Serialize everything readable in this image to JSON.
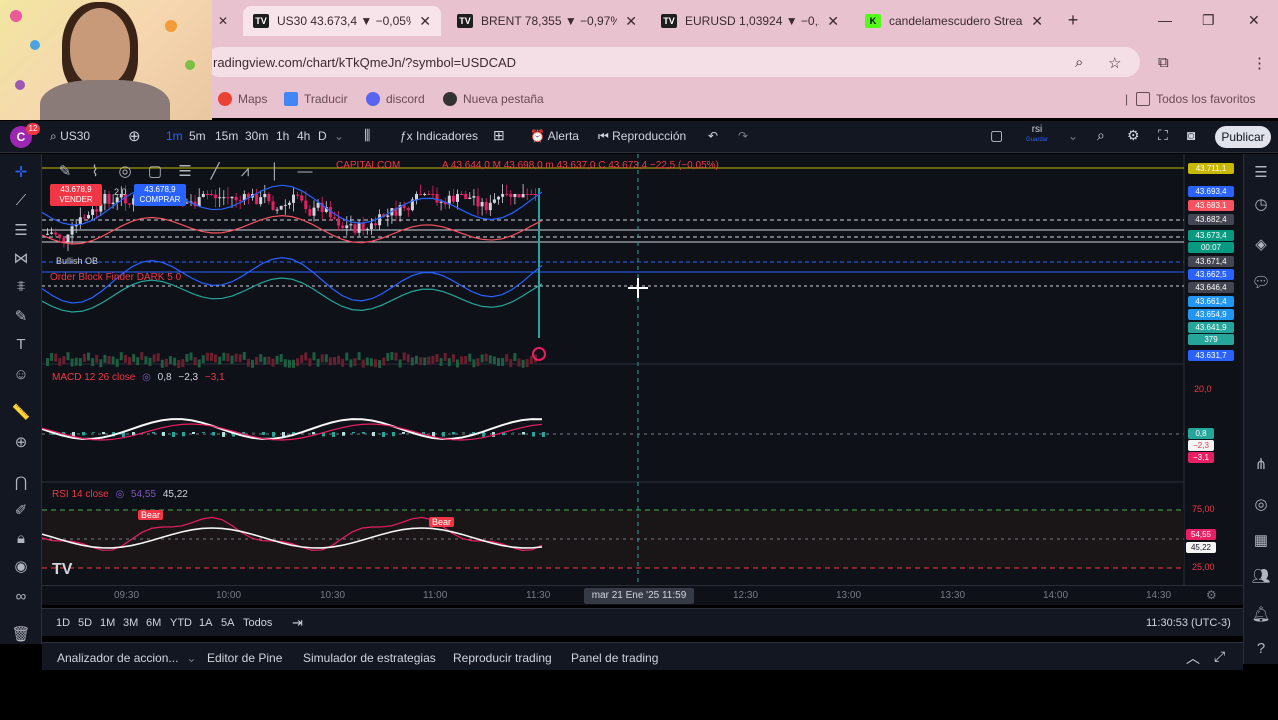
{
  "browser": {
    "tabs": [
      {
        "icon": "TV",
        "label": "US30 43.673,4 ▼ −0,05%"
      },
      {
        "icon": "TV",
        "label": "BRENT 78,355 ▼ −0,97%"
      },
      {
        "icon": "TV",
        "label": "EURUSD 1,03924 ▼ −0,2"
      },
      {
        "icon": "K",
        "label": "candelamescudero Strea"
      }
    ],
    "url": "radingview.com/chart/kTkQmeJn/?symbol=USDCAD",
    "bookmarks": [
      "Maps",
      "Traducir",
      "discord",
      "Nueva pestaña"
    ],
    "all_bookmarks": "Todos los favoritos"
  },
  "toolbar": {
    "symbol": "US30",
    "intervals": [
      "1m",
      "5m",
      "15m",
      "30m",
      "1h",
      "4h",
      "D"
    ],
    "indicators": "Indicadores",
    "alert": "Alerta",
    "replay": "Reproducción",
    "publish": "Publicar",
    "avatar": "C",
    "notif_count": "12",
    "layout_name": "rsi",
    "layout_sub": "Guardar"
  },
  "chart": {
    "source": "CAPITALCOM",
    "ohlc": "A 43.644,0  M 43.698,0  m 43.637,0  C 43.673,4  −22,5 (−0,05%)",
    "sell_price": "43.678,9",
    "sell_label": "VENDER",
    "buy_price": "43.678,9",
    "buy_label": "COMPRAR",
    "spread": "2,0",
    "block_label": "Order Block Finder DARK 5 0",
    "bullish_label": "Bullish OB",
    "macd_label": "MACD 12 26 close",
    "macd_values": [
      "0,8",
      "−2,3",
      "−3,1"
    ],
    "rsi_label": "RSI 14 close",
    "rsi_values": [
      "54,55",
      "45,22"
    ],
    "bear_labels": [
      "Bear",
      "Bear"
    ],
    "price_labels": [
      {
        "text": "43.711,1",
        "color": "#c9b800"
      },
      {
        "text": "43.693,4",
        "color": "#2962ff"
      },
      {
        "text": "43.683,1",
        "color": "#f7525f"
      },
      {
        "text": "43.682,4",
        "color": "#434651"
      },
      {
        "text": "43.673,4",
        "color": "#089981"
      },
      {
        "text": "00:07",
        "color": "#089981"
      },
      {
        "text": "43.671,4",
        "color": "#434651"
      },
      {
        "text": "43.662,5",
        "color": "#2962ff"
      },
      {
        "text": "43.646,4",
        "color": "#434651"
      },
      {
        "text": "43.661,4",
        "color": "#2196f3"
      },
      {
        "text": "43.654,9",
        "color": "#2196f3"
      },
      {
        "text": "43.641,9",
        "color": "#26a69a"
      },
      {
        "text": "379",
        "color": "#26a69a"
      },
      {
        "text": "43.631,7",
        "color": "#2962ff"
      }
    ],
    "macd_axis": [
      "20,0",
      "0,8",
      "−2,3",
      "−3,1"
    ],
    "rsi_axis": [
      "75,00",
      "54,55",
      "45,22",
      "25,00"
    ],
    "time_labels": [
      "09:30",
      "10:00",
      "10:30",
      "11:00",
      "11:30",
      "12:30",
      "13:00",
      "13:30",
      "14:00",
      "14:30"
    ],
    "crosshair_date": "mar 21 Ene '25  11:59"
  },
  "ranges": [
    "1D",
    "5D",
    "1M",
    "3M",
    "6M",
    "YTD",
    "1A",
    "5A",
    "Todos"
  ],
  "clock": "11:30:53 (UTC-3)",
  "bottom_tabs": [
    "Analizador de accion...",
    "Editor de Pine",
    "Simulador de estrategias",
    "Reproducir trading",
    "Panel de trading"
  ]
}
